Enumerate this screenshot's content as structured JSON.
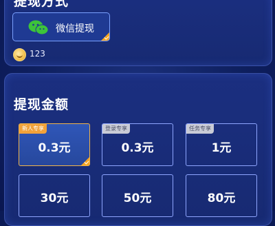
{
  "method_section": {
    "title": "提现方式",
    "wechat_label": "微信提现",
    "coin_balance": "123"
  },
  "amount_section": {
    "title": "提现金额",
    "options": [
      {
        "amount": "0.3元",
        "tag": "新人专享",
        "selected": true
      },
      {
        "amount": "0.3元",
        "tag": "登录专享",
        "selected": false
      },
      {
        "amount": "1元",
        "tag": "任务专享",
        "selected": false
      },
      {
        "amount": "30元",
        "tag": "",
        "selected": false
      },
      {
        "amount": "50元",
        "tag": "",
        "selected": false
      },
      {
        "amount": "80元",
        "tag": "",
        "selected": false
      }
    ]
  },
  "colors": {
    "background": "#0b1a55",
    "accent_orange": "#f2a23a",
    "tile_border": "#8fa6ff",
    "wechat_green": "#3dc43a"
  }
}
